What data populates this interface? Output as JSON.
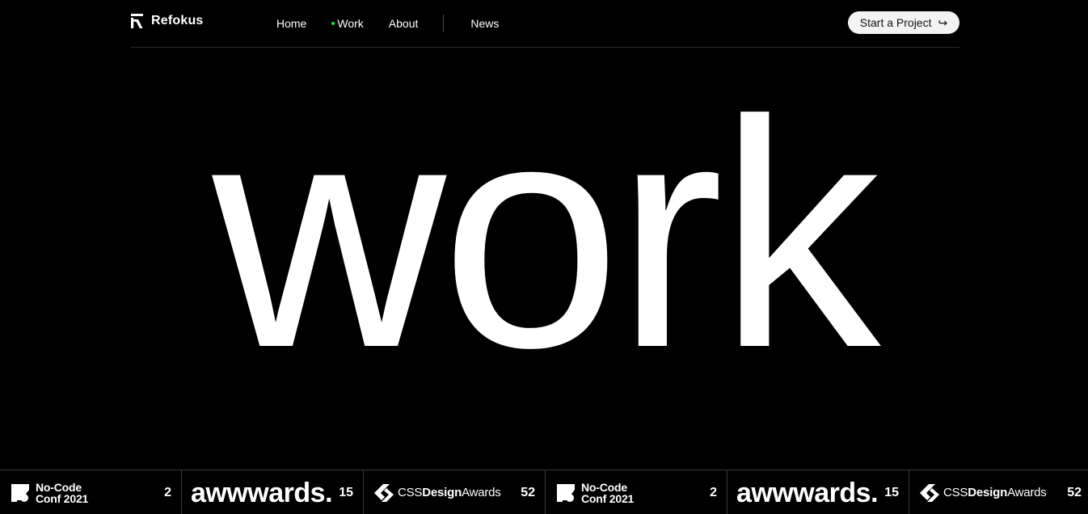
{
  "brand": {
    "name": "Refokus",
    "icon": "refokus-logo-icon"
  },
  "nav": {
    "items": [
      {
        "label": "Home",
        "active": false
      },
      {
        "label": "Work",
        "active": true
      },
      {
        "label": "About",
        "active": false
      },
      {
        "label": "News",
        "active": false
      }
    ],
    "active_indicator_color": "#19e340"
  },
  "cta": {
    "label": "Start a Project",
    "icon": "arrow-return-right-icon",
    "glyph": "↪"
  },
  "hero": {
    "word": "work"
  },
  "awards": [
    {
      "type": "nocode",
      "line1": "No-Code",
      "line2": "Conf 2021",
      "count": "2"
    },
    {
      "type": "awwwards",
      "name": "awwwards.",
      "count": "15"
    },
    {
      "type": "cssda",
      "name_light": "CSS",
      "name_bold": "Design",
      "name_tail": "Awards",
      "count": "52"
    },
    {
      "type": "nocode",
      "line1": "No-Code",
      "line2": "Conf 2021",
      "count": "2"
    },
    {
      "type": "awwwards",
      "name": "awwwards.",
      "count": "15"
    },
    {
      "type": "cssda",
      "name_light": "CSS",
      "name_bold": "Design",
      "name_tail": "Awards",
      "count": "52"
    }
  ],
  "colors": {
    "background": "#000000",
    "text": "#ffffff",
    "cta_background": "#f3f3f3",
    "divider": "#3a3a3a"
  }
}
